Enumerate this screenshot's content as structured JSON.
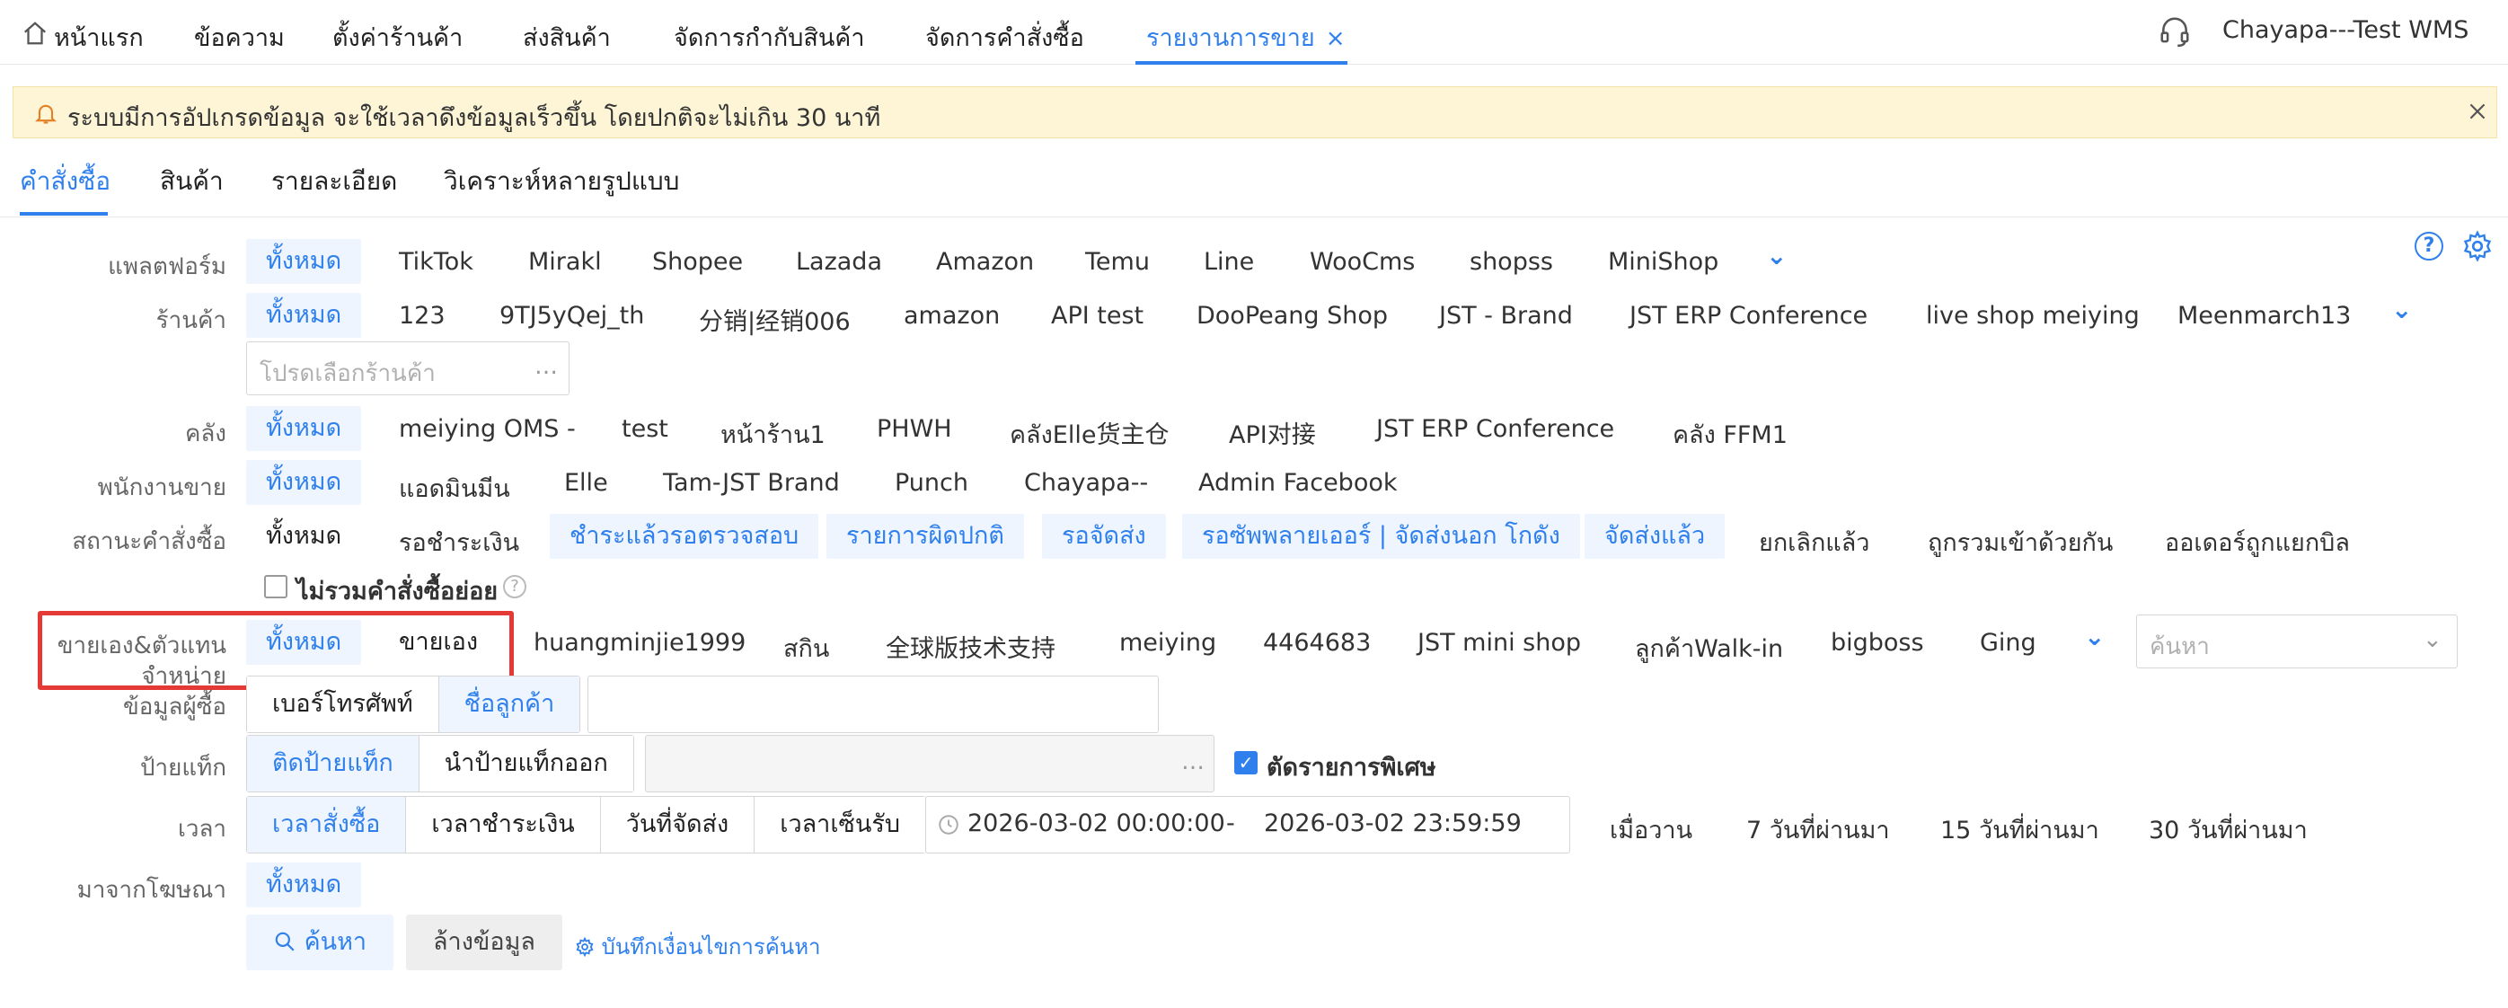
{
  "top_nav": {
    "tabs": [
      "หน้าแรก",
      "ข้อความ",
      "ตั้งค่าร้านค้า",
      "ส่งสินค้า",
      "จัดการกำกับสินค้า",
      "จัดการคำสั่งซื้อ",
      "รายงานการขาย"
    ],
    "active_tab": "รายงานการขาย",
    "close_symbol": "×",
    "user_name": "Chayapa---Test WMS"
  },
  "notice": {
    "text": "ระบบมีการอัปเกรดข้อมูล จะใช้เวลาดึงข้อมูลเร็วขึ้น โดยปกติจะไม่เกิน 30 นาที"
  },
  "sub_tabs": [
    "คำสั่งซื้อ",
    "สินค้า",
    "รายละเอียด",
    "วิเคราะห์หลายรูปแบบ"
  ],
  "filters": {
    "platform": {
      "label": "แพลตฟอร์ม",
      "options": [
        "ทั้งหมด",
        "TikTok",
        "Mirakl",
        "Shopee",
        "Lazada",
        "Amazon",
        "Temu",
        "Line",
        "WooCms",
        "shopss",
        "MiniShop"
      ]
    },
    "shop": {
      "label": "ร้านค้า",
      "options": [
        "ทั้งหมด",
        "123",
        "9TJ5yQej_th",
        "分销|经销006",
        "amazon",
        "API test",
        "DooPeang Shop",
        "JST - Brand",
        "JST ERP Conference",
        "live shop meiying",
        "Meenmarch13"
      ],
      "placeholder": "โปรดเลือกร้านค้า"
    },
    "warehouse": {
      "label": "คลัง",
      "options": [
        "ทั้งหมด",
        "meiying OMS -",
        "test",
        "หน้าร้าน1",
        "PHWH",
        "คลังElle货主仓",
        "API对接",
        "JST ERP Conference",
        "คลัง FFM1"
      ]
    },
    "salesperson": {
      "label": "พนักงานขาย",
      "options": [
        "ทั้งหมด",
        "แอดมินมีน",
        "Elle",
        "Tam-JST Brand",
        "Punch",
        "Chayapa--",
        "Admin Facebook"
      ]
    },
    "order_status": {
      "label": "สถานะคำสั่งซื้อ",
      "options": [
        "ทั้งหมด",
        "รอชำระเงิน",
        "ชำระแล้วรอตรวจสอบ",
        "รายการผิดปกติ",
        "รอจัดส่ง",
        "รอซัพพลายเออร์ | จัดส่งนอก โกดัง",
        "จัดส่งแล้ว",
        "ยกเลิกแล้ว",
        "ถูกรวมเข้าด้วยกัน",
        "ออเดอร์ถูกแยกบิล"
      ],
      "exclude_sub_orders": "ไม่รวมคำสั่งซื้อย่อย"
    },
    "self_and_agent": {
      "label_line1": "ขายเอง&ตัวแทน",
      "label_line2": "จำหน่าย",
      "options": [
        "ทั้งหมด",
        "ขายเอง",
        "huangminjie1999",
        "สกิน",
        "全球版技术支持",
        "meiying",
        "4464683",
        "JST mini shop",
        "ลูกค้าWalk-in",
        "bigboss",
        "Ging"
      ],
      "search_placeholder": "ค้นหา"
    },
    "buyer_info": {
      "label": "ข้อมูลผู้ซื้อ",
      "segments": [
        "เบอร์โทรศัพท์",
        "ชื่อลูกค้า"
      ]
    },
    "tag": {
      "label": "ป้ายแท็ก",
      "segments": [
        "ติดป้ายแท็ก",
        "นำป้ายแท็กออก"
      ],
      "special_items": "ตัดรายการพิเศษ"
    },
    "time": {
      "label": "เวลา",
      "segments": [
        "เวลาสั่งซื้อ",
        "เวลาชำระเงิน",
        "วันที่จัดส่ง",
        "เวลาเซ็นรับ"
      ],
      "start": "2026-03-02 00:00:00",
      "separator": "-",
      "end": "2026-03-02 23:59:59",
      "quick": [
        "เมื่อวาน",
        "7 วันที่ผ่านมา",
        "15 วันที่ผ่านมา",
        "30 วันที่ผ่านมา"
      ]
    },
    "ad_source": {
      "label": "มาจากโฆษณา",
      "options": [
        "ทั้งหมด"
      ]
    }
  },
  "actions": {
    "search": "ค้นหา",
    "clear": "ล้างข้อมูล",
    "save_condition": "บันทึกเงื่อนไขการค้นหา"
  },
  "icons": {
    "home": "home-icon",
    "headset": "headset-icon",
    "bell": "bell-icon",
    "help": "question-icon",
    "settings": "gear-icon"
  },
  "colors": {
    "accent": "#2f80ed",
    "highlight_box": "#e53935",
    "notice_bg": "#fdf5d6"
  }
}
